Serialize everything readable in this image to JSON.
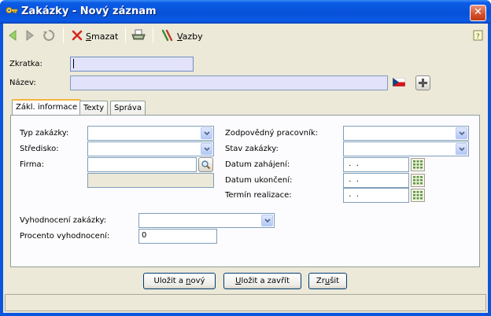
{
  "window": {
    "title": "Zakázky - Nový záznam",
    "close_glyph": "✕"
  },
  "toolbar": {
    "delete_label_pre": "",
    "delete_label_ul": "S",
    "delete_label_post": "mazat",
    "links_label_pre": "",
    "links_label_ul": "V",
    "links_label_post": "azby"
  },
  "header_fields": {
    "zkratka_label": "Zkratka:",
    "zkratka_value": "",
    "nazev_label": "Název:",
    "nazev_value": ""
  },
  "tabs": [
    {
      "label": "Zákl. informace",
      "active": true
    },
    {
      "label": "Texty",
      "active": false
    },
    {
      "label": "Správa",
      "active": false
    }
  ],
  "form": {
    "typ_label": "Typ zakázky:",
    "typ_value": "",
    "stredisko_label": "Středisko:",
    "stredisko_value": "",
    "firma_label": "Firma:",
    "firma_value": "",
    "firma_detail": "",
    "zodpovedny_label": "Zodpovědný pracovník:",
    "zodpovedny_value": "",
    "stav_label": "Stav zakázky:",
    "stav_value": "",
    "datum_zahajeni_label": "Datum zahájení:",
    "datum_zahajeni_value": " .  .",
    "datum_ukonceni_label": "Datum ukončení:",
    "datum_ukonceni_value": " .  .",
    "termin_label": "Termín realizace:",
    "termin_value": " .  .",
    "vyhodnoceni_label": "Vyhodnocení zakázky:",
    "vyhodnoceni_value": "",
    "procento_label": "Procento vyhodnocení:",
    "procento_value": "0"
  },
  "buttons": {
    "save_new_pre": "Uložit a ",
    "save_new_ul": "n",
    "save_new_post": "ový",
    "save_close_pre": "",
    "save_close_ul": "U",
    "save_close_post": "ložit a zavřít",
    "cancel_pre": "Zr",
    "cancel_ul": "u",
    "cancel_post": "šit"
  },
  "colors": {
    "titlebar": "#0a55e0",
    "client_bg": "#ece9d8",
    "required_field": "#e2e2fa",
    "tab_highlight": "#f5b43d"
  }
}
